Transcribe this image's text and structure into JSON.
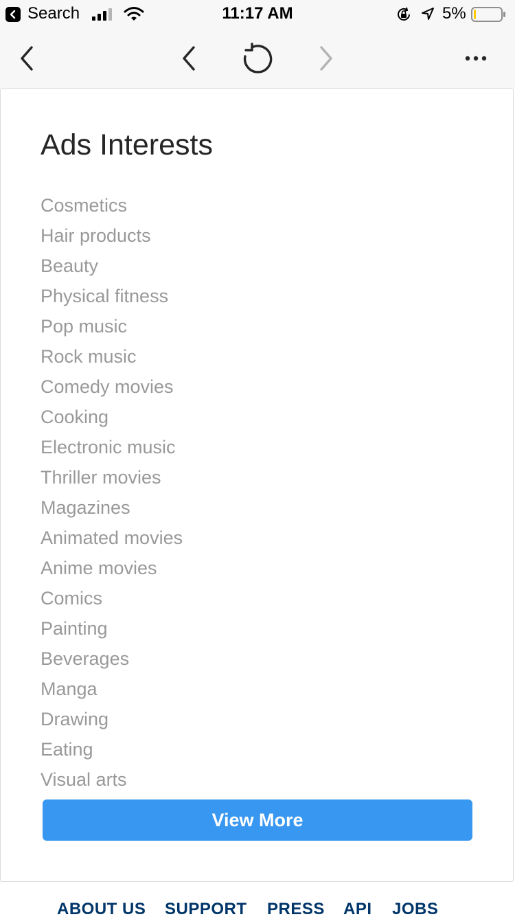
{
  "status_bar": {
    "back_app_label": "Search",
    "time": "11:17 AM",
    "battery_percent": "5%",
    "icons": [
      "chevron-left-icon",
      "signal-bars-icon",
      "wifi-icon",
      "rotation-lock-icon",
      "location-arrow-icon",
      "battery-icon"
    ],
    "battery_level": 0.05,
    "battery_color": "#ffcc00"
  },
  "nav_bar": {
    "icons": [
      "close-back-icon",
      "back-arrow-icon",
      "reload-icon",
      "forward-arrow-icon",
      "more-icon"
    ]
  },
  "card": {
    "title": "Ads Interests",
    "interests": [
      "Cosmetics",
      "Hair products",
      "Beauty",
      "Physical fitness",
      "Pop music",
      "Rock music",
      "Comedy movies",
      "Cooking",
      "Electronic music",
      "Thriller movies",
      "Magazines",
      "Animated movies",
      "Anime movies",
      "Comics",
      "Painting",
      "Beverages",
      "Manga",
      "Drawing",
      "Eating",
      "Visual arts"
    ],
    "view_more_label": "View More"
  },
  "footer": {
    "links": [
      "ABOUT US",
      "SUPPORT",
      "PRESS",
      "API",
      "JOBS"
    ]
  },
  "colors": {
    "accent": "#3897f0",
    "footer_link": "#003569",
    "muted_text": "#999999"
  }
}
